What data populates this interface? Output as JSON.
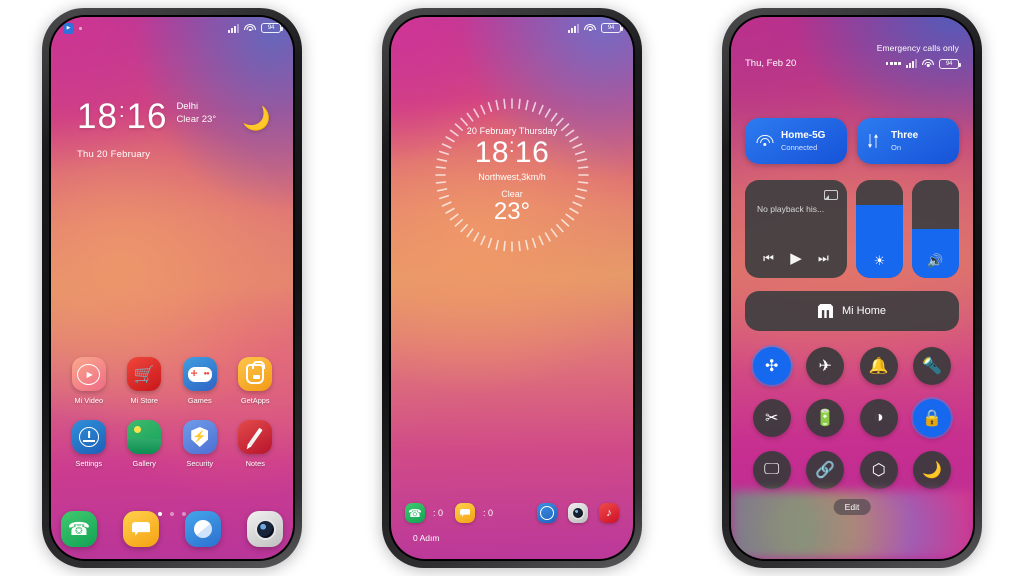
{
  "meta": {
    "background_color": "#ffffff",
    "accent_blue": "#1668ef",
    "panel_gray": "#3e3e40"
  },
  "phone1": {
    "statusbar": {
      "battery": "94"
    },
    "clock": {
      "hours": "18",
      "separator": ":",
      "minutes": "16",
      "city": "Delhi",
      "condition": "Clear 23°",
      "date": "Thu 20 February",
      "weather_icon": "🌙"
    },
    "apps_row1": [
      {
        "label": "Mi Video",
        "icon": "play-circle-icon"
      },
      {
        "label": "Mi Store",
        "icon": "shopping-cart-icon"
      },
      {
        "label": "Games",
        "icon": "gamepad-icon"
      },
      {
        "label": "GetApps",
        "icon": "shopping-bag-icon"
      }
    ],
    "apps_row2": [
      {
        "label": "Settings",
        "icon": "gear-icon"
      },
      {
        "label": "Gallery",
        "icon": "landscape-icon"
      },
      {
        "label": "Security",
        "icon": "shield-bolt-icon"
      },
      {
        "label": "Notes",
        "icon": "pencil-icon"
      }
    ],
    "page_dots": {
      "count": 3,
      "active_index": 0
    },
    "dock": [
      {
        "name": "phone-app",
        "icon": "phone-icon"
      },
      {
        "name": "messages-app",
        "icon": "message-icon"
      },
      {
        "name": "browser-app",
        "icon": "browser-icon"
      },
      {
        "name": "camera-app",
        "icon": "camera-icon"
      }
    ]
  },
  "phone2": {
    "statusbar": {
      "battery": "94"
    },
    "clock_widget": {
      "date": "20 February Thursday",
      "hours": "18",
      "separator": ":",
      "minutes": "16",
      "wind": "Northwest,3km/h",
      "condition": "Clear",
      "temperature": "23°",
      "ring_ticks": 60
    },
    "dock": {
      "missed_calls": "0",
      "unread_messages": "0",
      "separator": ":",
      "right_icons": [
        {
          "name": "browser-app",
          "icon": "compass-icon"
        },
        {
          "name": "camera-app",
          "icon": "camera-icon"
        },
        {
          "name": "tiktok-app",
          "icon": "music-note-icon"
        }
      ]
    },
    "steps": "0 Adım"
  },
  "phone3": {
    "header": {
      "carrier_status": "Emergency calls only",
      "date": "Thu, Feb 20",
      "battery": "94"
    },
    "connectivity_pills": [
      {
        "title": "Home-5G",
        "subtitle": "Connected",
        "icon": "wifi-icon",
        "active": true
      },
      {
        "title": "Three",
        "subtitle": "On",
        "icon": "mobile-data-icon",
        "active": true
      }
    ],
    "media": {
      "title": "No playback his...",
      "cast_icon": "cast-icon",
      "prev": "⏮",
      "play": "▶",
      "next": "⏭"
    },
    "sliders": [
      {
        "name": "brightness-slider",
        "icon": "☀",
        "value": 75
      },
      {
        "name": "volume-slider",
        "icon": "🔊",
        "value": 50
      }
    ],
    "mi_home": {
      "label": "Mi Home",
      "icon": "mi-logo-icon"
    },
    "toggles": [
      {
        "name": "bluetooth",
        "glyph": "✣",
        "on": true
      },
      {
        "name": "airplane-mode",
        "glyph": "✈",
        "on": false
      },
      {
        "name": "ringtone",
        "glyph": "🔔",
        "on": false
      },
      {
        "name": "flashlight",
        "glyph": "🔦",
        "on": false
      },
      {
        "name": "screenshot",
        "glyph": "✂",
        "on": false
      },
      {
        "name": "battery-saver",
        "glyph": "🔋",
        "on": false
      },
      {
        "name": "dark-mode",
        "glyph": "◑",
        "on": false
      },
      {
        "name": "rotation-lock",
        "glyph": "🔒",
        "on": true
      },
      {
        "name": "cast",
        "glyph": "🖵",
        "on": false
      },
      {
        "name": "sync",
        "glyph": "🔗",
        "on": false
      },
      {
        "name": "location",
        "glyph": "⬡",
        "on": false
      },
      {
        "name": "do-not-disturb",
        "glyph": "🌙",
        "on": false
      }
    ],
    "edit_label": "Edit"
  }
}
